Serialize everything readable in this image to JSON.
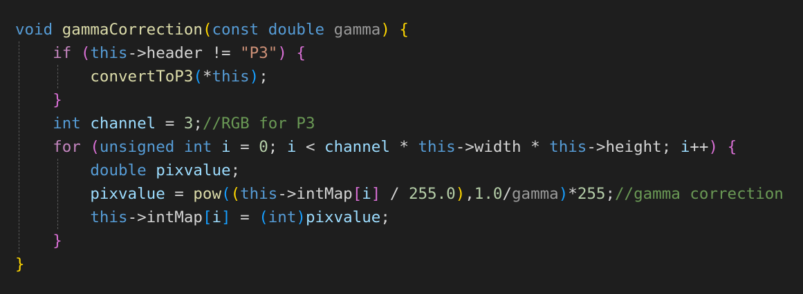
{
  "editor": {
    "theme": {
      "background": "#1e1e1e",
      "keyword": "#569cd6",
      "control": "#c586c0",
      "function": "#dcdcaa",
      "identifier": "#9cdcfe",
      "parameter": "#9a9a9a",
      "number": "#b5cea8",
      "string": "#ce9178",
      "comment": "#6a9955",
      "bracket_level_1": "#ffd700",
      "bracket_level_2": "#da70d6",
      "bracket_level_3": "#179fff"
    },
    "lines": [
      [
        {
          "t": "void",
          "c": "kw"
        },
        {
          "t": " ",
          "c": "op"
        },
        {
          "t": "gammaCorrection",
          "c": "fn"
        },
        {
          "t": "(",
          "c": "b1"
        },
        {
          "t": "const",
          "c": "kw"
        },
        {
          "t": " ",
          "c": "op"
        },
        {
          "t": "double",
          "c": "kw"
        },
        {
          "t": " ",
          "c": "op"
        },
        {
          "t": "gamma",
          "c": "prm"
        },
        {
          "t": ")",
          "c": "b1"
        },
        {
          "t": " ",
          "c": "op"
        },
        {
          "t": "{",
          "c": "b1"
        }
      ],
      [
        {
          "t": "    ",
          "c": "op"
        },
        {
          "t": "if",
          "c": "ctl"
        },
        {
          "t": " ",
          "c": "op"
        },
        {
          "t": "(",
          "c": "b2"
        },
        {
          "t": "this",
          "c": "kw"
        },
        {
          "t": "->header != ",
          "c": "op"
        },
        {
          "t": "\"P3\"",
          "c": "str"
        },
        {
          "t": ")",
          "c": "b2"
        },
        {
          "t": " ",
          "c": "op"
        },
        {
          "t": "{",
          "c": "b2"
        }
      ],
      [
        {
          "t": "        ",
          "c": "op"
        },
        {
          "t": "convertToP3",
          "c": "fn"
        },
        {
          "t": "(",
          "c": "b3"
        },
        {
          "t": "*",
          "c": "op"
        },
        {
          "t": "this",
          "c": "kw"
        },
        {
          "t": ")",
          "c": "b3"
        },
        {
          "t": ";",
          "c": "op"
        }
      ],
      [
        {
          "t": "    ",
          "c": "op"
        },
        {
          "t": "}",
          "c": "b2"
        }
      ],
      [
        {
          "t": "    ",
          "c": "op"
        },
        {
          "t": "int",
          "c": "kw"
        },
        {
          "t": " ",
          "c": "op"
        },
        {
          "t": "channel",
          "c": "id"
        },
        {
          "t": " = ",
          "c": "op"
        },
        {
          "t": "3",
          "c": "num"
        },
        {
          "t": ";",
          "c": "op"
        },
        {
          "t": "//RGB for P3",
          "c": "cmt"
        }
      ],
      [
        {
          "t": "    ",
          "c": "op"
        },
        {
          "t": "for",
          "c": "ctl"
        },
        {
          "t": " ",
          "c": "op"
        },
        {
          "t": "(",
          "c": "b2"
        },
        {
          "t": "unsigned",
          "c": "kw"
        },
        {
          "t": " ",
          "c": "op"
        },
        {
          "t": "int",
          "c": "kw"
        },
        {
          "t": " ",
          "c": "op"
        },
        {
          "t": "i",
          "c": "id"
        },
        {
          "t": " = ",
          "c": "op"
        },
        {
          "t": "0",
          "c": "num"
        },
        {
          "t": "; ",
          "c": "op"
        },
        {
          "t": "i",
          "c": "id"
        },
        {
          "t": " < ",
          "c": "op"
        },
        {
          "t": "channel",
          "c": "id"
        },
        {
          "t": " * ",
          "c": "op"
        },
        {
          "t": "this",
          "c": "kw"
        },
        {
          "t": "->width * ",
          "c": "op"
        },
        {
          "t": "this",
          "c": "kw"
        },
        {
          "t": "->height; ",
          "c": "op"
        },
        {
          "t": "i",
          "c": "id"
        },
        {
          "t": "++",
          "c": "op"
        },
        {
          "t": ")",
          "c": "b2"
        },
        {
          "t": " ",
          "c": "op"
        },
        {
          "t": "{",
          "c": "b2"
        }
      ],
      [
        {
          "t": "        ",
          "c": "op"
        },
        {
          "t": "double",
          "c": "kw"
        },
        {
          "t": " ",
          "c": "op"
        },
        {
          "t": "pixvalue",
          "c": "id"
        },
        {
          "t": ";",
          "c": "op"
        }
      ],
      [
        {
          "t": "        ",
          "c": "op"
        },
        {
          "t": "pixvalue",
          "c": "id"
        },
        {
          "t": " = ",
          "c": "op"
        },
        {
          "t": "pow",
          "c": "fn"
        },
        {
          "t": "(",
          "c": "b3"
        },
        {
          "t": "(",
          "c": "b1"
        },
        {
          "t": "this",
          "c": "kw"
        },
        {
          "t": "->intMap",
          "c": "op"
        },
        {
          "t": "[",
          "c": "b2"
        },
        {
          "t": "i",
          "c": "id"
        },
        {
          "t": "]",
          "c": "b2"
        },
        {
          "t": " / ",
          "c": "op"
        },
        {
          "t": "255.0",
          "c": "num"
        },
        {
          "t": ")",
          "c": "b1"
        },
        {
          "t": ",",
          "c": "op"
        },
        {
          "t": "1.0",
          "c": "num"
        },
        {
          "t": "/",
          "c": "op"
        },
        {
          "t": "gamma",
          "c": "prm"
        },
        {
          "t": ")",
          "c": "b3"
        },
        {
          "t": "*",
          "c": "op"
        },
        {
          "t": "255",
          "c": "num"
        },
        {
          "t": ";",
          "c": "op"
        },
        {
          "t": "//gamma correction",
          "c": "cmt"
        }
      ],
      [
        {
          "t": "        ",
          "c": "op"
        },
        {
          "t": "this",
          "c": "kw"
        },
        {
          "t": "->intMap",
          "c": "op"
        },
        {
          "t": "[",
          "c": "b3"
        },
        {
          "t": "i",
          "c": "id"
        },
        {
          "t": "]",
          "c": "b3"
        },
        {
          "t": " = ",
          "c": "op"
        },
        {
          "t": "(",
          "c": "b3"
        },
        {
          "t": "int",
          "c": "kw"
        },
        {
          "t": ")",
          "c": "b3"
        },
        {
          "t": "pixvalue",
          "c": "id"
        },
        {
          "t": ";",
          "c": "op"
        }
      ],
      [
        {
          "t": "    ",
          "c": "op"
        },
        {
          "t": "}",
          "c": "b2"
        }
      ],
      [
        {
          "t": "}",
          "c": "b1"
        }
      ]
    ]
  }
}
